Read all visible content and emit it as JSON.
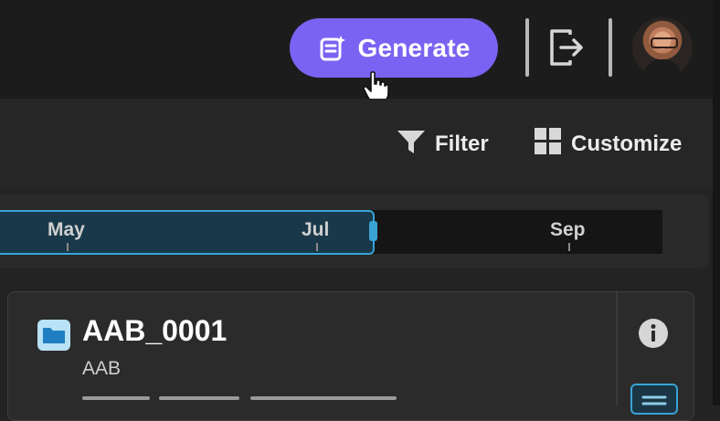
{
  "header": {
    "generate_label": "Generate",
    "icons": [
      "generate-doc-icon",
      "export-icon",
      "user-avatar"
    ]
  },
  "toolbar": {
    "filter_label": "Filter",
    "customize_label": "Customize"
  },
  "timeline": {
    "ticks": [
      "May",
      "Jul",
      "Sep"
    ]
  },
  "card": {
    "title": "AAB_0001",
    "subtitle": "AAB"
  },
  "colors": {
    "accent": "#7a63f2",
    "range": "#3aa3d6"
  }
}
